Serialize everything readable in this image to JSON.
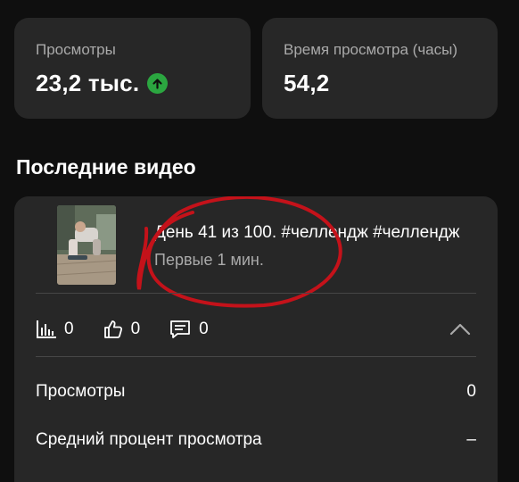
{
  "stats": [
    {
      "label": "Просмотры",
      "value": "23,2 тыс.",
      "trend": "up",
      "trend_icon": "arrow-up-circle-icon",
      "trend_color": "#2ba640"
    },
    {
      "label": "Время просмотра (часы)",
      "value": "54,2"
    }
  ],
  "section_title": "Последние видео",
  "video": {
    "title": "День 41 из 100. #челлендж #челлендж",
    "subtitle": "Первые 1 мин.",
    "metrics": [
      {
        "icon": "bar-chart-icon",
        "value": "0"
      },
      {
        "icon": "thumbs-up-icon",
        "value": "0"
      },
      {
        "icon": "comment-icon",
        "value": "0"
      }
    ],
    "expand_icon": "chevron-up-icon",
    "details": [
      {
        "label": "Просмотры",
        "value": "0"
      },
      {
        "label": "Средний процент просмотра",
        "value": "–"
      }
    ]
  },
  "colors": {
    "background": "#0f0f0f",
    "card": "#272727",
    "secondary_text": "#aaaaaa",
    "annotation": "#c4121a"
  }
}
